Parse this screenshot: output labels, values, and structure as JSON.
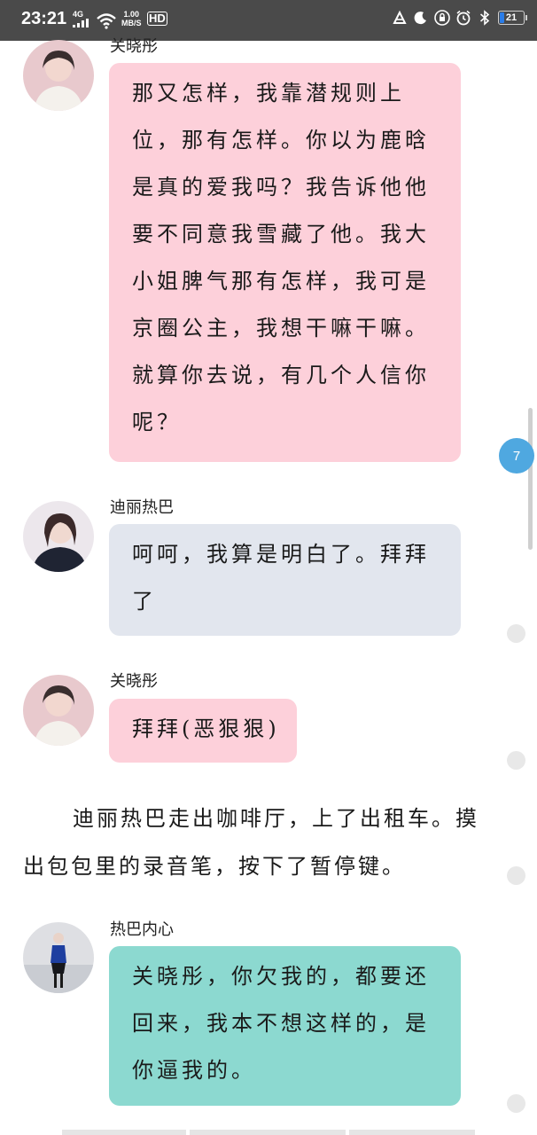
{
  "status_bar": {
    "time": "23:21",
    "net_type": "4G",
    "speed_value": "1.00",
    "speed_unit": "MB/S",
    "hd_label": "HD",
    "battery_level": "21"
  },
  "messages": [
    {
      "speaker": "关晓彤",
      "text": "那又怎样，我靠潜规则上位，那有怎样。你以为鹿晗是真的爱我吗？我告诉他他要不同意我雪藏了他。我大小姐脾气那有怎样，我可是京圈公主，我想干嘛干嘛。就算你去说，有几个人信你呢？",
      "bubble_color": "#fdd0da"
    },
    {
      "speaker": "迪丽热巴",
      "text": "呵呵，我算是明白了。拜拜了",
      "bubble_color": "#e2e6ee"
    },
    {
      "speaker": "关晓彤",
      "text": "拜拜(恶狠狠)",
      "bubble_color": "#fdd0da"
    },
    {
      "speaker": "热巴内心",
      "text": "关晓彤，你欠我的，都要还回来，我本不想这样的，是你逼我的。",
      "bubble_color": "#8cd9d0"
    }
  ],
  "narration": "迪丽热巴走出咖啡厅，上了出租车。摸出包包里的录音笔，按下了暂停键。",
  "page_indicator": "7"
}
